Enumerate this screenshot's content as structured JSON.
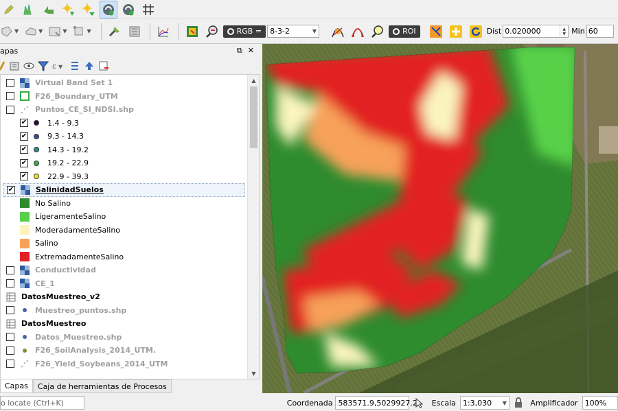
{
  "toolbar2": {
    "rgb_label": "RGB =",
    "rgb_value": "8-3-2",
    "roi_label": "ROI",
    "dist_label": "Dist",
    "dist_value": "0.020000",
    "min_label": "Min",
    "min_value": "60"
  },
  "panel": {
    "title": "apas",
    "float_icon": "⧉",
    "close_icon": "✕"
  },
  "layers": [
    {
      "label": "Virtual Band Set 1",
      "checked": false,
      "style": "grey",
      "icon": "raster-icon"
    },
    {
      "label": "F26_Boundary_UTM",
      "checked": false,
      "style": "grey",
      "icon": "polygon-icon"
    },
    {
      "label": "Puntos_CE_SI_NDSI.shp",
      "checked": false,
      "style": "grey",
      "icon": "points-icon"
    },
    {
      "label": "1.4 - 9.3",
      "checked": true,
      "style": "class",
      "color": "#2d0a3a"
    },
    {
      "label": "9.3 - 14.3",
      "checked": true,
      "style": "class",
      "color": "#3b4f8c"
    },
    {
      "label": "14.3 - 19.2",
      "checked": true,
      "style": "class",
      "color": "#2a8a88"
    },
    {
      "label": "19.2 - 22.9",
      "checked": true,
      "style": "class",
      "color": "#3fae4f"
    },
    {
      "label": "22.9 - 39.3",
      "checked": true,
      "style": "class",
      "color": "#efe12a"
    },
    {
      "label": "SalinidadSuelos",
      "checked": true,
      "style": "selected",
      "icon": "raster-icon"
    },
    {
      "label": "No Salino",
      "style": "swatch",
      "color": "#2e8b2e"
    },
    {
      "label": "LigeramenteSalino",
      "style": "swatch",
      "color": "#58d149"
    },
    {
      "label": "ModeradamenteSalino",
      "style": "swatch",
      "color": "#fbf4bf"
    },
    {
      "label": "Salino",
      "style": "swatch",
      "color": "#f7a15a"
    },
    {
      "label": "ExtremadamenteSalino",
      "style": "swatch",
      "color": "#e22222"
    },
    {
      "label": "Conductividad",
      "checked": false,
      "style": "grey",
      "icon": "raster-icon"
    },
    {
      "label": "CE_1",
      "checked": false,
      "style": "grey",
      "icon": "raster-icon"
    },
    {
      "label": "DatosMuestreo_v2",
      "style": "bold",
      "icon": "table-icon"
    },
    {
      "label": "Muestreo_puntos.shp",
      "checked": false,
      "style": "grey",
      "icon": "point-blue-icon"
    },
    {
      "label": "DatosMuestreo",
      "style": "bold",
      "icon": "table-icon"
    },
    {
      "label": "Datos_Muestreo.shp",
      "checked": false,
      "style": "grey",
      "icon": "point-blue-icon"
    },
    {
      "label": "F26_SoilAnalysis_2014_UTM.",
      "checked": false,
      "style": "grey",
      "icon": "point-olive-icon"
    },
    {
      "label": "F26_Yield_Soybeans_2014_UTM",
      "checked": false,
      "style": "grey",
      "icon": "points-icon"
    }
  ],
  "tabs": {
    "layers": "Capas",
    "processing": "Caja de herramientas de Procesos"
  },
  "status": {
    "locate_placeholder": "o locate (Ctrl+K)",
    "coord_label": "Coordenada",
    "coord_value": "583571.9,5029927.2",
    "scale_label": "Escala",
    "scale_value": "1:3,030",
    "magnifier_label": "Amplificador",
    "magnifier_value": "100%"
  },
  "colors": {
    "no_salino": "#2e8b2e",
    "ligeramente": "#58d149",
    "moderadamente": "#fbf4bf",
    "salino": "#f7a15a",
    "extremadamente": "#e22222"
  }
}
